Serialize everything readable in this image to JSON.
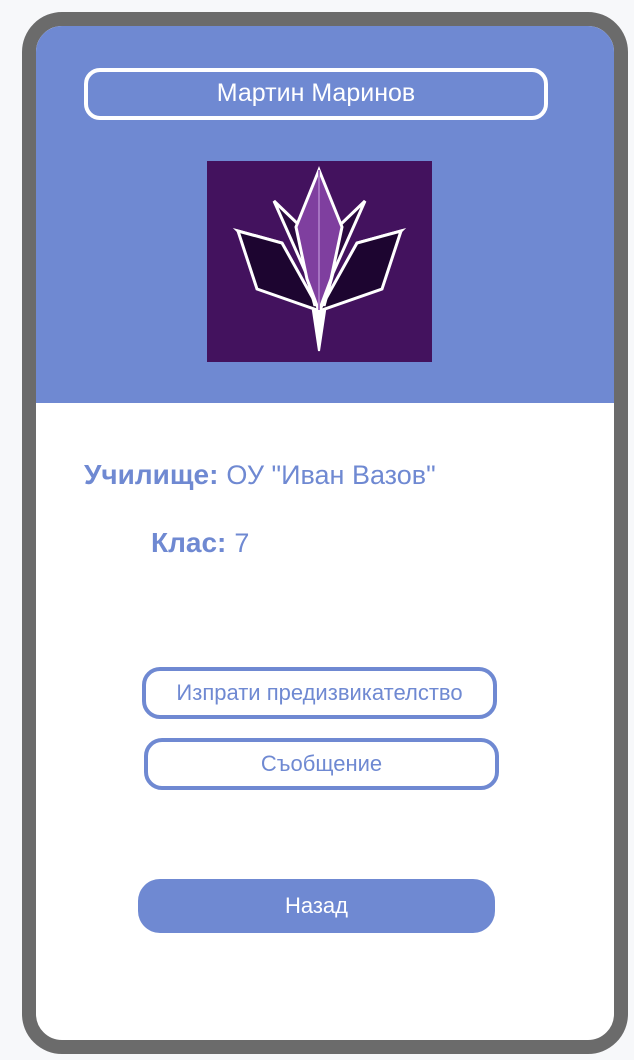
{
  "profile": {
    "name": "Мартин Маринов",
    "logo_icon": "crystal-lotus-logo-icon"
  },
  "info": {
    "school_label": "Училище:",
    "school_value": "ОУ \"Иван Вазов\"",
    "class_label": "Клас:",
    "class_value": "7"
  },
  "actions": {
    "challenge_label": "Изпрати предизвикателство",
    "message_label": "Съобщение",
    "back_label": "Назад"
  },
  "colors": {
    "accent": "#6f89d2",
    "frame": "#6b6b6b",
    "logo_bg": "#43125e",
    "logo_inner": "#7f3f9f"
  }
}
